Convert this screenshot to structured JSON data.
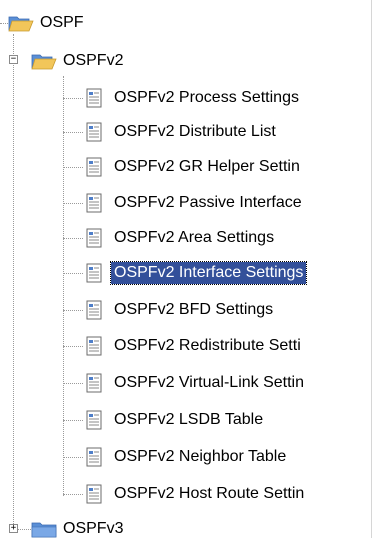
{
  "tree": {
    "root": {
      "label": "OSPF",
      "icon": "folder-open-icon"
    },
    "ospfv2": {
      "label": "OSPFv2",
      "expanded": true,
      "expander_symbol": "−",
      "icon": "folder-open-icon",
      "items": [
        {
          "label": "OSPFv2 Process Settings",
          "icon": "page-icon"
        },
        {
          "label": "OSPFv2 Distribute List",
          "icon": "page-icon"
        },
        {
          "label": "OSPFv2 GR Helper Settin",
          "icon": "page-icon"
        },
        {
          "label": "OSPFv2 Passive Interface",
          "icon": "page-icon"
        },
        {
          "label": "OSPFv2 Area Settings",
          "icon": "page-icon"
        },
        {
          "label": "OSPFv2 Interface Settings",
          "icon": "page-icon",
          "selected": true
        },
        {
          "label": "OSPFv2 BFD Settings",
          "icon": "page-icon"
        },
        {
          "label": "OSPFv2 Redistribute Setti",
          "icon": "page-icon"
        },
        {
          "label": "OSPFv2 Virtual-Link Settin",
          "icon": "page-icon"
        },
        {
          "label": "OSPFv2 LSDB Table",
          "icon": "page-icon"
        },
        {
          "label": "OSPFv2 Neighbor Table",
          "icon": "page-icon"
        },
        {
          "label": "OSPFv2 Host Route Settin",
          "icon": "page-icon"
        }
      ]
    },
    "ospfv3": {
      "label": "OSPFv3",
      "expanded": false,
      "expander_symbol": "+",
      "icon": "folder-closed-icon"
    }
  },
  "colors": {
    "selection_bg": "#33509a",
    "selection_text": "#ffffff",
    "folder": "#e8b84a",
    "folder_blue": "#5a8fd6"
  }
}
